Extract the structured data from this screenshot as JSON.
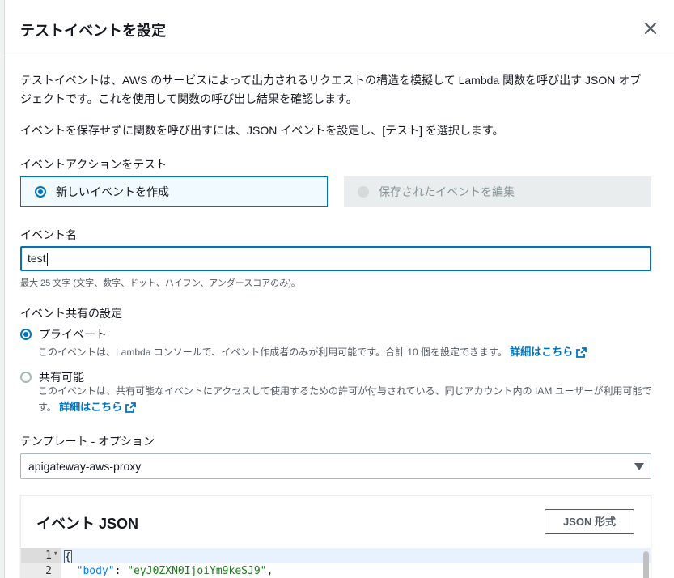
{
  "modal": {
    "title": "テストイベントを設定",
    "close_icon": "close-icon"
  },
  "intro": {
    "description": "テストイベントは、AWS のサービスによって出力されるリクエストの構造を模擬して Lambda 関数を呼び出す JSON オブジェクトです。これを使用して関数の呼び出し結果を確認します。",
    "instruction": "イベントを保存せずに関数を呼び出すには、JSON イベントを設定し、[テスト] を選択します。"
  },
  "event_action": {
    "label": "イベントアクションをテスト",
    "options": [
      {
        "label": "新しいイベントを作成",
        "selected": true,
        "disabled": false
      },
      {
        "label": "保存されたイベントを編集",
        "selected": false,
        "disabled": true
      }
    ]
  },
  "event_name": {
    "label": "イベント名",
    "value": "test",
    "hint": "最大 25 文字 (文字、数字、ドット、ハイフン、アンダースコアのみ)。"
  },
  "sharing": {
    "label": "イベント共有の設定",
    "private": {
      "label": "プライベート",
      "selected": true,
      "description": "このイベントは、Lambda コンソールで、イベント作成者のみが利用可能です。合計 10 個を設定できます。",
      "link": "詳細はこちら"
    },
    "shared": {
      "label": "共有可能",
      "selected": false,
      "description": "このイベントは、共有可能なイベントにアクセスして使用するための許可が付与されている、同じアカウント内の IAM ユーザーが利用可能です。",
      "link": "詳細はこちら"
    }
  },
  "template": {
    "label": "テンプレート - オプション",
    "value": "apigateway-aws-proxy"
  },
  "event_json": {
    "title": "イベント JSON",
    "format_button": "JSON 形式",
    "lines": [
      {
        "number": "1",
        "text": "{"
      },
      {
        "number": "2",
        "key": "\"body\"",
        "sep": ": ",
        "value": "\"eyJ0ZXN0IjoiYm9keSJ9\"",
        "tail": ","
      }
    ]
  },
  "colors": {
    "accent": "#0073bb",
    "disabled_bg": "#eaeded",
    "text": "#16191f"
  }
}
